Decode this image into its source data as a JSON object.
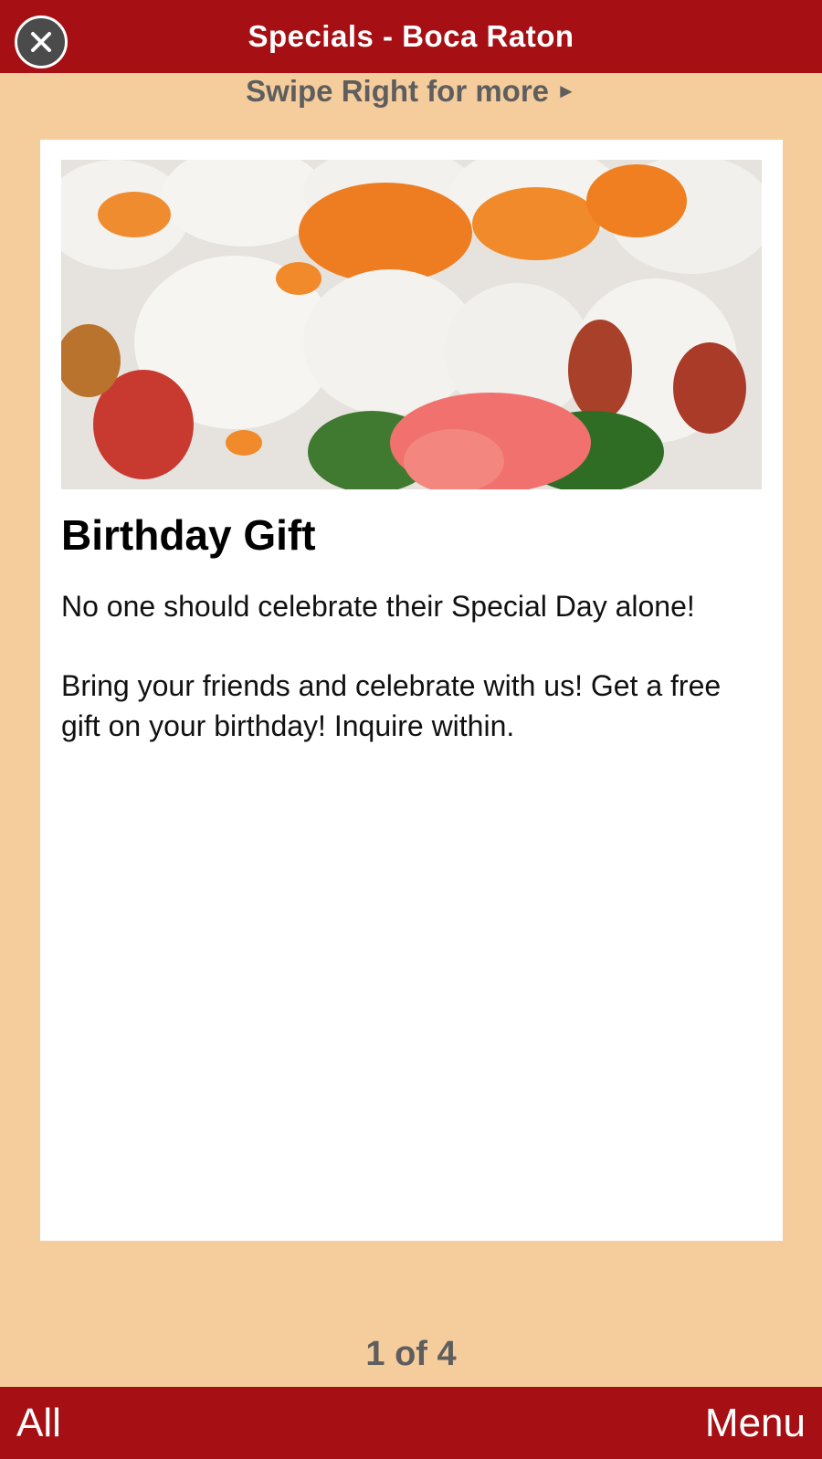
{
  "header": {
    "title": "Specials - Boca Raton",
    "close_icon": "close-icon"
  },
  "hint": {
    "text": "Swipe Right for more",
    "arrow": "►"
  },
  "special": {
    "image_icon": "sushi-photo",
    "title": "Birthday Gift",
    "paragraph_1": "No one should celebrate their Special Day alone!",
    "paragraph_2": "Bring your friends and celebrate with us! Get a free gift on your birthday! Inquire within."
  },
  "pager": {
    "text": "1 of 4"
  },
  "footer": {
    "left_label": "All",
    "right_label": "Menu"
  },
  "colors": {
    "bar": "#a61014",
    "background": "#f5cc9c",
    "card": "#ffffff",
    "muted_text": "#5e5e5e"
  }
}
